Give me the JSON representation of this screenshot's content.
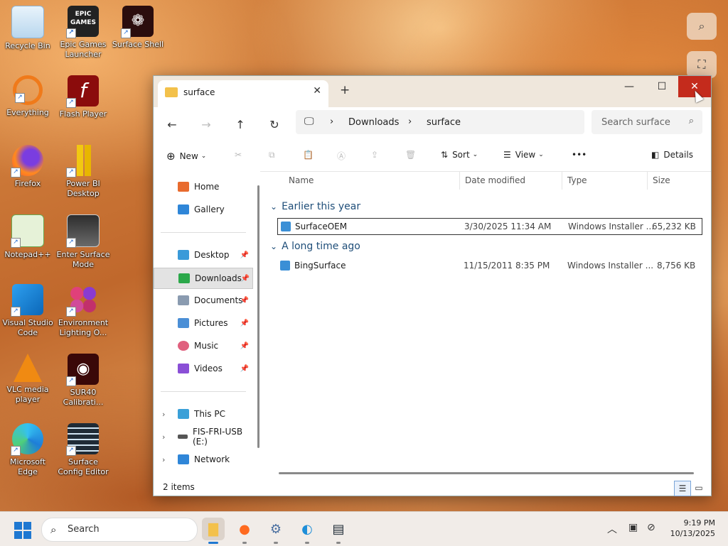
{
  "desktop": {
    "icons": [
      {
        "label": "Recycle Bin"
      },
      {
        "label": "Epic Games Launcher",
        "logo_text": "EPIC GAMES"
      },
      {
        "label": "Surface Shell"
      },
      {
        "label": "Everything"
      },
      {
        "label": "Flash Player"
      },
      {
        "label": "Firefox"
      },
      {
        "label": "Power BI Desktop"
      },
      {
        "label": "Notepad++"
      },
      {
        "label": "Enter Surface Mode"
      },
      {
        "label": "Visual Studio Code"
      },
      {
        "label": "Environment Lighting O..."
      },
      {
        "label": "VLC media player"
      },
      {
        "label": "SUR40 Calibrati..."
      },
      {
        "label": "Microsoft Edge"
      },
      {
        "label": "Surface Config Editor"
      }
    ]
  },
  "explorer": {
    "tab_title": "surface",
    "new_tab": "+",
    "window_controls": {
      "minimize": "—",
      "maximize": "☐",
      "close": "✕"
    },
    "breadcrumb": [
      "Downloads",
      "surface"
    ],
    "search_placeholder": "Search surface",
    "toolbar": {
      "new": "New",
      "sort": "Sort",
      "view": "View",
      "more": "•••",
      "details": "Details"
    },
    "sidebar": {
      "quick": [
        {
          "label": "Home"
        },
        {
          "label": "Gallery"
        }
      ],
      "pinned": [
        {
          "label": "Desktop"
        },
        {
          "label": "Downloads"
        },
        {
          "label": "Documents"
        },
        {
          "label": "Pictures"
        },
        {
          "label": "Music"
        },
        {
          "label": "Videos"
        }
      ],
      "devices": [
        {
          "label": "This PC"
        },
        {
          "label": "FIS-FRI-USB (E:)"
        },
        {
          "label": "Network"
        }
      ]
    },
    "columns": [
      "Name",
      "Date modified",
      "Type",
      "Size"
    ],
    "groups": [
      {
        "title": "Earlier this year",
        "files": [
          {
            "name": "SurfaceOEM",
            "date": "3/30/2025 11:34 AM",
            "type": "Windows Installer ...",
            "size": "65,232 KB"
          }
        ]
      },
      {
        "title": "A long time ago",
        "files": [
          {
            "name": "BingSurface",
            "date": "11/15/2011 8:35 PM",
            "type": "Windows Installer ...",
            "size": "8,756 KB"
          }
        ]
      }
    ],
    "status_count": "2 items"
  },
  "taskbar": {
    "search_placeholder": "Search",
    "clock_time": "9:19 PM",
    "clock_date": "10/13/2025"
  },
  "colors": {
    "accent": "#1f78d1",
    "close_hover": "#c42b1c"
  }
}
